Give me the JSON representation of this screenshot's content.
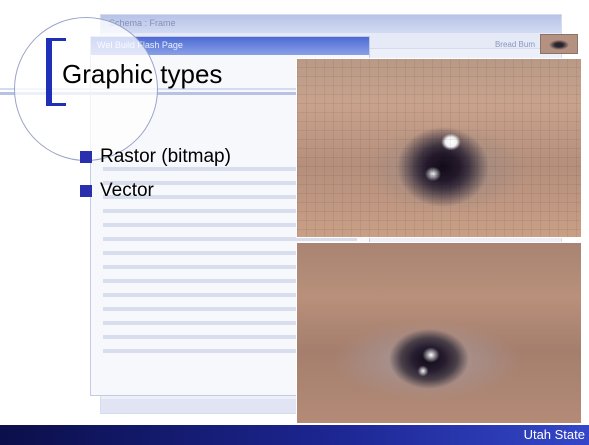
{
  "slide": {
    "title": "Graphic types",
    "bullets": [
      {
        "text": "Rastor (bitmap)"
      },
      {
        "text": "Vector"
      }
    ],
    "footer": "Utah State"
  },
  "background_window": {
    "title": "Schema : Frame",
    "dialog_title": "Wel  Build Flash Page",
    "link_text": "Bread Bum"
  },
  "images": [
    {
      "name": "pixelated-eye-photo",
      "description_label": ""
    },
    {
      "name": "smooth-eye-photo",
      "description_label": ""
    }
  ],
  "colors": {
    "accent": "#1f2fb8",
    "bullet": "#2a2fae",
    "footer_dark": "#0b0f4a",
    "footer_light": "#3447c8"
  }
}
